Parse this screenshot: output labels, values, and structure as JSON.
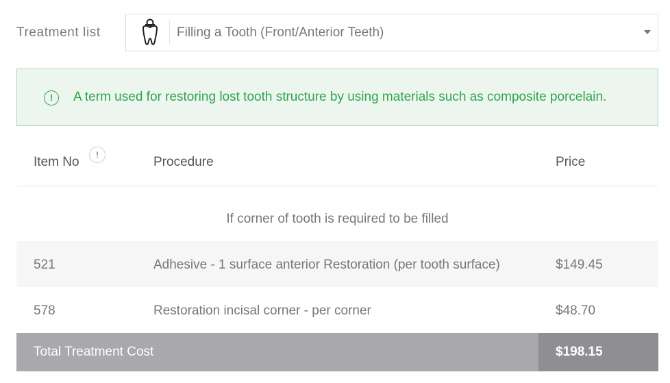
{
  "treatment": {
    "label": "Treatment list",
    "selected": "Filling a Tooth (Front/Anterior Teeth)",
    "icon": "tooth-icon"
  },
  "info": {
    "icon": "info-icon",
    "glyph": "!",
    "text": "A term used for restoring lost tooth structure by using materials such as composite porcelain.",
    "color": "#2ea44f"
  },
  "table": {
    "headers": {
      "item_no": "Item No",
      "item_no_badge": "!",
      "procedure": "Procedure",
      "price": "Price"
    },
    "group_label": "If corner of tooth is required to be filled",
    "rows": [
      {
        "item_no": "521",
        "procedure": "Adhesive - 1 surface anterior Restoration (per tooth surface)",
        "price": "$149.45"
      },
      {
        "item_no": "578",
        "procedure": "Restoration incisal corner - per corner",
        "price": "$48.70"
      }
    ],
    "total": {
      "label": "Total Treatment Cost",
      "price": "$198.15"
    }
  }
}
